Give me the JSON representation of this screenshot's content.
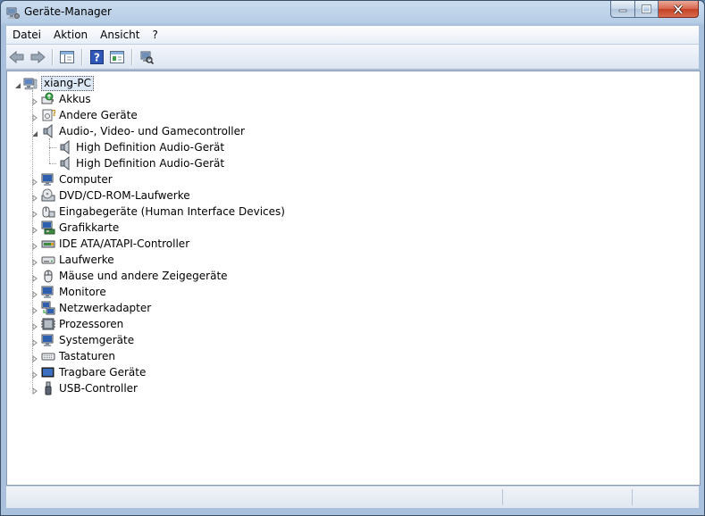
{
  "window": {
    "title": "Geräte-Manager",
    "icon": "device-manager-icon",
    "buttons": [
      "minimize-icon",
      "maximize-icon",
      "close-icon"
    ]
  },
  "menu": {
    "items": [
      {
        "label": "Datei"
      },
      {
        "label": "Aktion"
      },
      {
        "label": "Ansicht"
      },
      {
        "label": "?"
      }
    ]
  },
  "toolbar": {
    "buttons": [
      "back-arrow-icon",
      "forward-arrow-icon",
      "show-hide-console-tree-icon",
      "help-icon",
      "properties-icon",
      "scan-hardware-icon"
    ]
  },
  "tree": {
    "root": {
      "label": "xiang-PC",
      "icon": "computer-icon",
      "expanded": true,
      "selected": true
    },
    "items": [
      {
        "label": "Akkus",
        "icon": "battery-icon",
        "expanded": false
      },
      {
        "label": "Andere Geräte",
        "icon": "unknown-device-icon",
        "expanded": false
      },
      {
        "label": "Audio-, Video- und Gamecontroller",
        "icon": "speaker-icon",
        "expanded": true,
        "children": [
          {
            "label": "High Definition Audio-Gerät",
            "icon": "speaker-icon"
          },
          {
            "label": "High Definition Audio-Gerät",
            "icon": "speaker-icon"
          }
        ]
      },
      {
        "label": "Computer",
        "icon": "monitor-icon",
        "expanded": false
      },
      {
        "label": "DVD/CD-ROM-Laufwerke",
        "icon": "dvd-drive-icon",
        "expanded": false
      },
      {
        "label": "Eingabegeräte (Human Interface Devices)",
        "icon": "hid-icon",
        "expanded": false
      },
      {
        "label": "Grafikkarte",
        "icon": "display-adapter-icon",
        "expanded": false
      },
      {
        "label": "IDE ATA/ATAPI-Controller",
        "icon": "ide-controller-icon",
        "expanded": false
      },
      {
        "label": "Laufwerke",
        "icon": "disk-drive-icon",
        "expanded": false
      },
      {
        "label": "Mäuse und andere Zeigegeräte",
        "icon": "mouse-icon",
        "expanded": false
      },
      {
        "label": "Monitore",
        "icon": "monitor-icon",
        "expanded": false
      },
      {
        "label": "Netzwerkadapter",
        "icon": "network-adapter-icon",
        "expanded": false
      },
      {
        "label": "Prozessoren",
        "icon": "processor-icon",
        "expanded": false
      },
      {
        "label": "Systemgeräte",
        "icon": "system-device-icon",
        "expanded": false
      },
      {
        "label": "Tastaturen",
        "icon": "keyboard-icon",
        "expanded": false
      },
      {
        "label": "Tragbare Geräte",
        "icon": "portable-device-icon",
        "expanded": false
      },
      {
        "label": "USB-Controller",
        "icon": "usb-icon",
        "expanded": false
      }
    ]
  },
  "statusbar": {
    "text": ""
  },
  "colors": {
    "titlebar": "#b7cde6",
    "close_button": "#c44124",
    "selection": "#dde8f5"
  }
}
